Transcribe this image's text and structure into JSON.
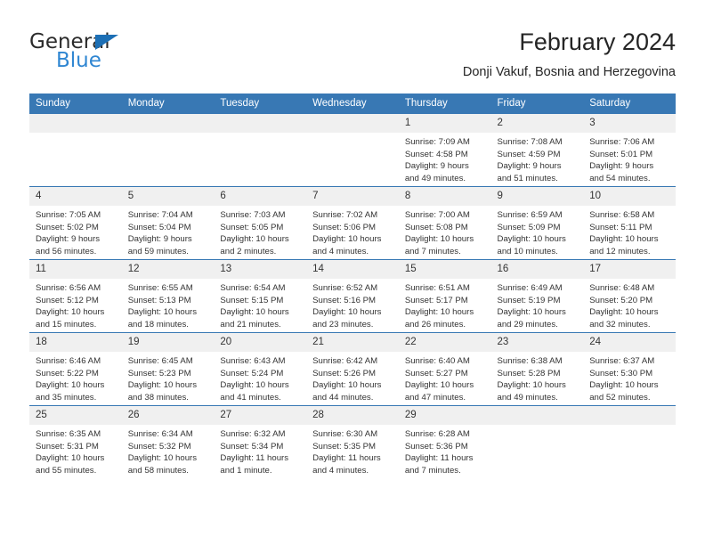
{
  "logo": {
    "word1": "General",
    "word2": "Blue",
    "triangle_color": "#1c6fb5",
    "blue_color": "#2f86d2"
  },
  "header": {
    "title": "February 2024",
    "subtitle": "Donji Vakuf, Bosnia and Herzegovina"
  },
  "theme": {
    "header_bg": "#3878b4",
    "daynum_bg": "#f0f0f0",
    "row_rule": "#3878b4",
    "text": "#333333"
  },
  "weekdays": [
    "Sunday",
    "Monday",
    "Tuesday",
    "Wednesday",
    "Thursday",
    "Friday",
    "Saturday"
  ],
  "weeks": [
    [
      {
        "day": "",
        "lines": []
      },
      {
        "day": "",
        "lines": []
      },
      {
        "day": "",
        "lines": []
      },
      {
        "day": "",
        "lines": []
      },
      {
        "day": "1",
        "lines": [
          "Sunrise: 7:09 AM",
          "Sunset: 4:58 PM",
          "Daylight: 9 hours",
          "and 49 minutes."
        ]
      },
      {
        "day": "2",
        "lines": [
          "Sunrise: 7:08 AM",
          "Sunset: 4:59 PM",
          "Daylight: 9 hours",
          "and 51 minutes."
        ]
      },
      {
        "day": "3",
        "lines": [
          "Sunrise: 7:06 AM",
          "Sunset: 5:01 PM",
          "Daylight: 9 hours",
          "and 54 minutes."
        ]
      }
    ],
    [
      {
        "day": "4",
        "lines": [
          "Sunrise: 7:05 AM",
          "Sunset: 5:02 PM",
          "Daylight: 9 hours",
          "and 56 minutes."
        ]
      },
      {
        "day": "5",
        "lines": [
          "Sunrise: 7:04 AM",
          "Sunset: 5:04 PM",
          "Daylight: 9 hours",
          "and 59 minutes."
        ]
      },
      {
        "day": "6",
        "lines": [
          "Sunrise: 7:03 AM",
          "Sunset: 5:05 PM",
          "Daylight: 10 hours",
          "and 2 minutes."
        ]
      },
      {
        "day": "7",
        "lines": [
          "Sunrise: 7:02 AM",
          "Sunset: 5:06 PM",
          "Daylight: 10 hours",
          "and 4 minutes."
        ]
      },
      {
        "day": "8",
        "lines": [
          "Sunrise: 7:00 AM",
          "Sunset: 5:08 PM",
          "Daylight: 10 hours",
          "and 7 minutes."
        ]
      },
      {
        "day": "9",
        "lines": [
          "Sunrise: 6:59 AM",
          "Sunset: 5:09 PM",
          "Daylight: 10 hours",
          "and 10 minutes."
        ]
      },
      {
        "day": "10",
        "lines": [
          "Sunrise: 6:58 AM",
          "Sunset: 5:11 PM",
          "Daylight: 10 hours",
          "and 12 minutes."
        ]
      }
    ],
    [
      {
        "day": "11",
        "lines": [
          "Sunrise: 6:56 AM",
          "Sunset: 5:12 PM",
          "Daylight: 10 hours",
          "and 15 minutes."
        ]
      },
      {
        "day": "12",
        "lines": [
          "Sunrise: 6:55 AM",
          "Sunset: 5:13 PM",
          "Daylight: 10 hours",
          "and 18 minutes."
        ]
      },
      {
        "day": "13",
        "lines": [
          "Sunrise: 6:54 AM",
          "Sunset: 5:15 PM",
          "Daylight: 10 hours",
          "and 21 minutes."
        ]
      },
      {
        "day": "14",
        "lines": [
          "Sunrise: 6:52 AM",
          "Sunset: 5:16 PM",
          "Daylight: 10 hours",
          "and 23 minutes."
        ]
      },
      {
        "day": "15",
        "lines": [
          "Sunrise: 6:51 AM",
          "Sunset: 5:17 PM",
          "Daylight: 10 hours",
          "and 26 minutes."
        ]
      },
      {
        "day": "16",
        "lines": [
          "Sunrise: 6:49 AM",
          "Sunset: 5:19 PM",
          "Daylight: 10 hours",
          "and 29 minutes."
        ]
      },
      {
        "day": "17",
        "lines": [
          "Sunrise: 6:48 AM",
          "Sunset: 5:20 PM",
          "Daylight: 10 hours",
          "and 32 minutes."
        ]
      }
    ],
    [
      {
        "day": "18",
        "lines": [
          "Sunrise: 6:46 AM",
          "Sunset: 5:22 PM",
          "Daylight: 10 hours",
          "and 35 minutes."
        ]
      },
      {
        "day": "19",
        "lines": [
          "Sunrise: 6:45 AM",
          "Sunset: 5:23 PM",
          "Daylight: 10 hours",
          "and 38 minutes."
        ]
      },
      {
        "day": "20",
        "lines": [
          "Sunrise: 6:43 AM",
          "Sunset: 5:24 PM",
          "Daylight: 10 hours",
          "and 41 minutes."
        ]
      },
      {
        "day": "21",
        "lines": [
          "Sunrise: 6:42 AM",
          "Sunset: 5:26 PM",
          "Daylight: 10 hours",
          "and 44 minutes."
        ]
      },
      {
        "day": "22",
        "lines": [
          "Sunrise: 6:40 AM",
          "Sunset: 5:27 PM",
          "Daylight: 10 hours",
          "and 47 minutes."
        ]
      },
      {
        "day": "23",
        "lines": [
          "Sunrise: 6:38 AM",
          "Sunset: 5:28 PM",
          "Daylight: 10 hours",
          "and 49 minutes."
        ]
      },
      {
        "day": "24",
        "lines": [
          "Sunrise: 6:37 AM",
          "Sunset: 5:30 PM",
          "Daylight: 10 hours",
          "and 52 minutes."
        ]
      }
    ],
    [
      {
        "day": "25",
        "lines": [
          "Sunrise: 6:35 AM",
          "Sunset: 5:31 PM",
          "Daylight: 10 hours",
          "and 55 minutes."
        ]
      },
      {
        "day": "26",
        "lines": [
          "Sunrise: 6:34 AM",
          "Sunset: 5:32 PM",
          "Daylight: 10 hours",
          "and 58 minutes."
        ]
      },
      {
        "day": "27",
        "lines": [
          "Sunrise: 6:32 AM",
          "Sunset: 5:34 PM",
          "Daylight: 11 hours",
          "and 1 minute."
        ]
      },
      {
        "day": "28",
        "lines": [
          "Sunrise: 6:30 AM",
          "Sunset: 5:35 PM",
          "Daylight: 11 hours",
          "and 4 minutes."
        ]
      },
      {
        "day": "29",
        "lines": [
          "Sunrise: 6:28 AM",
          "Sunset: 5:36 PM",
          "Daylight: 11 hours",
          "and 7 minutes."
        ]
      },
      {
        "day": "",
        "lines": []
      },
      {
        "day": "",
        "lines": []
      }
    ]
  ]
}
